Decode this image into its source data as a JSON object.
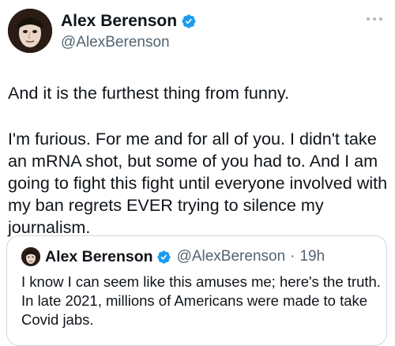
{
  "author": {
    "display_name": "Alex Berenson",
    "handle": "@AlexBerenson",
    "verified": true
  },
  "tweet": {
    "paragraph_1": "And it is the furthest thing from funny.",
    "paragraph_2": "I'm furious. For me and for all of you. I didn't take an mRNA shot, but some of you had to. And I am going to fight this fight until everyone involved with my ban regrets EVER trying to silence my journalism."
  },
  "quoted_tweet": {
    "display_name": "Alex Berenson",
    "handle": "@AlexBerenson",
    "separator": "·",
    "time": "19h",
    "text": "I know I can seem like this amuses me; here's the truth. In late 2021, millions of Americans were made to take Covid jabs."
  },
  "icons": {
    "verified": "verified-badge-icon",
    "more": "more-options-icon"
  },
  "colors": {
    "verified_blue": "#1d9bf0",
    "secondary_text": "#536471",
    "border": "#cfd9de"
  }
}
